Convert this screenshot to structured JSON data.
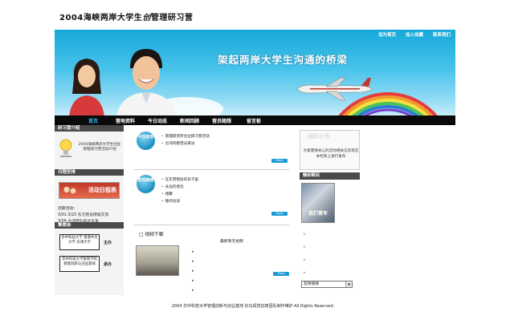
{
  "site": {
    "title_prefix": "2004海峡两岸大学生",
    "title_sig": "创",
    "title_suffix": "管理研习营"
  },
  "banner": {
    "top_links": [
      "设为首页",
      "加入收藏",
      "联系我们"
    ],
    "slogan": "架起两岸大学生沟通的桥梁"
  },
  "nav": {
    "items": [
      "首页",
      "营地资料",
      "今日动态",
      "新闻回顾",
      "营员随想",
      "留言板"
    ]
  },
  "sidebar": {
    "intro_header": "研习营介绍",
    "intro_text": "2004海峡两岸大学生创业管理研习营活动介绍",
    "schedule_header": "日程安排",
    "schedule_image_label": "活动日程表",
    "recent_label": "近期活动：",
    "recent_items": [
      "3/01-3/25 东方营员持续交流",
      "3/26 台湾团队抵达天津"
    ],
    "committee_header": "筹委会",
    "committee": [
      {
        "box": "华中科技大学 香港中文大学 天津大学",
        "role": "主办"
      },
      {
        "box": "华中科技大学管理学院 管理创新与创业基地",
        "role": "承办"
      }
    ]
  },
  "center": {
    "block1_badge": "今日动态",
    "block1_items": [
      "管理研究所创业研习营活动",
      "台湾同胞营员来访"
    ],
    "block2_badge": "营员随想",
    "block2_items": [
      "在东营相处的日子里",
      "永远的感念",
      "相聚",
      "静间也语"
    ],
    "more_label": "More",
    "video_header": "□ 视频下载",
    "video_note": "最新暂无视频",
    "video_bullets": [
      "▸",
      "▸",
      "▸",
      "▸",
      "▸"
    ]
  },
  "right": {
    "notice_title": "通知公告",
    "notice_text": "大家需要关心的活动相关信息等在本栏目上进行发布",
    "photo_header": "精彩瞬间",
    "photo_caption": "我们青年",
    "arrows": [
      "▸",
      "▸",
      "▸",
      "▸"
    ],
    "select_value": "友情链接"
  },
  "footer": {
    "text": "2004 华中科技大学管理创新与创业基地  红鸟视觉创意团队制作维护  All Rights Reserved."
  }
}
